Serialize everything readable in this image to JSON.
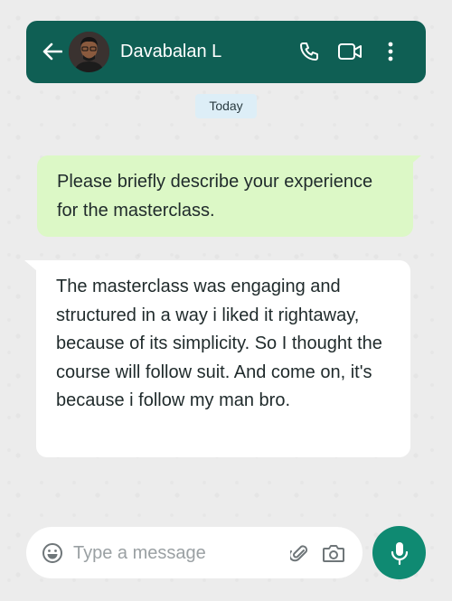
{
  "header": {
    "contact_name": "Davabalan L",
    "icons": [
      "back-arrow-icon",
      "avatar",
      "phone-icon",
      "video-camera-icon",
      "more-vertical-icon"
    ]
  },
  "date_chip": "Today",
  "messages": [
    {
      "direction": "outgoing",
      "text": "Please briefly describe your experience for the masterclass."
    },
    {
      "direction": "incoming",
      "text": "The masterclass was engaging and structured in a way i liked it rightaway, because of its simplicity. So I thought the course will follow suit. And come on, it's because i follow my man bro."
    }
  ],
  "composer": {
    "placeholder": "Type a message",
    "value": "",
    "icons": [
      "emoji-icon",
      "attachment-icon",
      "camera-icon",
      "microphone-icon"
    ]
  },
  "colors": {
    "header_bg": "#0f5f54",
    "outgoing_bubble": "#dcf8c6",
    "incoming_bubble": "#ffffff",
    "date_chip_bg": "#ddeef7",
    "mic_button": "#0f8a72",
    "background": "#ececec"
  }
}
